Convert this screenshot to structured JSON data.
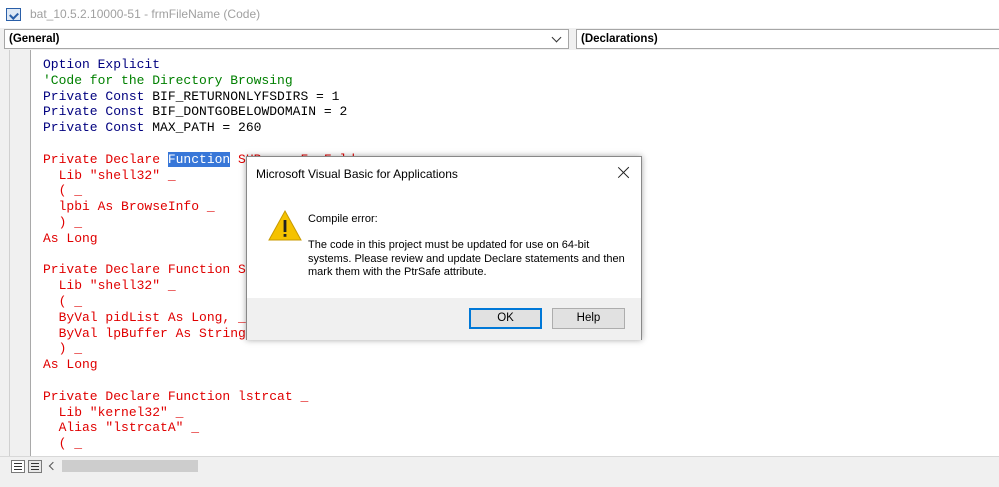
{
  "window": {
    "title": "bat_10.5.2.10000-51 - frmFileName (Code)"
  },
  "combos": {
    "object": "(General)",
    "procedure": "(Declarations)"
  },
  "code_lines": [
    [
      {
        "t": "Option Explicit",
        "c": "kw"
      }
    ],
    [
      {
        "t": "'Code for the Directory Browsing",
        "c": "cmt"
      }
    ],
    [
      {
        "t": "Private Const",
        "c": "kw"
      },
      {
        "t": " BIF_RETURNONLYFSDIRS = 1",
        "c": ""
      }
    ],
    [
      {
        "t": "Private Const",
        "c": "kw"
      },
      {
        "t": " BIF_DONTGOBELOWDOMAIN = 2",
        "c": ""
      }
    ],
    [
      {
        "t": "Private Const",
        "c": "kw"
      },
      {
        "t": " MAX_PATH = 260",
        "c": ""
      }
    ],
    [],
    [
      {
        "t": "Private Declare ",
        "c": "red"
      },
      {
        "t": "Function",
        "c": "sel"
      },
      {
        "t": " SHBrowseForFolder _",
        "c": "red"
      }
    ],
    [
      {
        "t": "  Lib \"shell32\" _",
        "c": "red"
      }
    ],
    [
      {
        "t": "  ( _",
        "c": "red"
      }
    ],
    [
      {
        "t": "  lpbi As BrowseInfo _",
        "c": "red"
      }
    ],
    [
      {
        "t": "  ) _",
        "c": "red"
      }
    ],
    [
      {
        "t": "As Long",
        "c": "red"
      }
    ],
    [],
    [
      {
        "t": "Private Declare Function SHGetPathFromIDList _",
        "c": "red"
      }
    ],
    [
      {
        "t": "  Lib \"shell32\" _",
        "c": "red"
      }
    ],
    [
      {
        "t": "  ( _",
        "c": "red"
      }
    ],
    [
      {
        "t": "  ByVal pidList As Long, _",
        "c": "red"
      }
    ],
    [
      {
        "t": "  ByVal lpBuffer As String _",
        "c": "red"
      }
    ],
    [
      {
        "t": "  ) _",
        "c": "red"
      }
    ],
    [
      {
        "t": "As Long",
        "c": "red"
      }
    ],
    [],
    [
      {
        "t": "Private Declare Function lstrcat _",
        "c": "red"
      }
    ],
    [
      {
        "t": "  Lib \"kernel32\" _",
        "c": "red"
      }
    ],
    [
      {
        "t": "  Alias \"lstrcatA\" _",
        "c": "red"
      }
    ],
    [
      {
        "t": "  ( _",
        "c": "red"
      }
    ]
  ],
  "dialog": {
    "title": "Microsoft Visual Basic for Applications",
    "heading": "Compile error:",
    "message": "The code in this project must be updated for use on 64-bit systems.  Please review and update Declare statements and then mark them with the PtrSafe attribute.",
    "ok_label": "OK",
    "help_label": "Help",
    "icon": "warning-icon"
  },
  "colors": {
    "keyword": "#00007f",
    "comment": "#008000",
    "error_line": "#e00000",
    "selection": "#3877d8",
    "focus_border": "#0078d7"
  }
}
